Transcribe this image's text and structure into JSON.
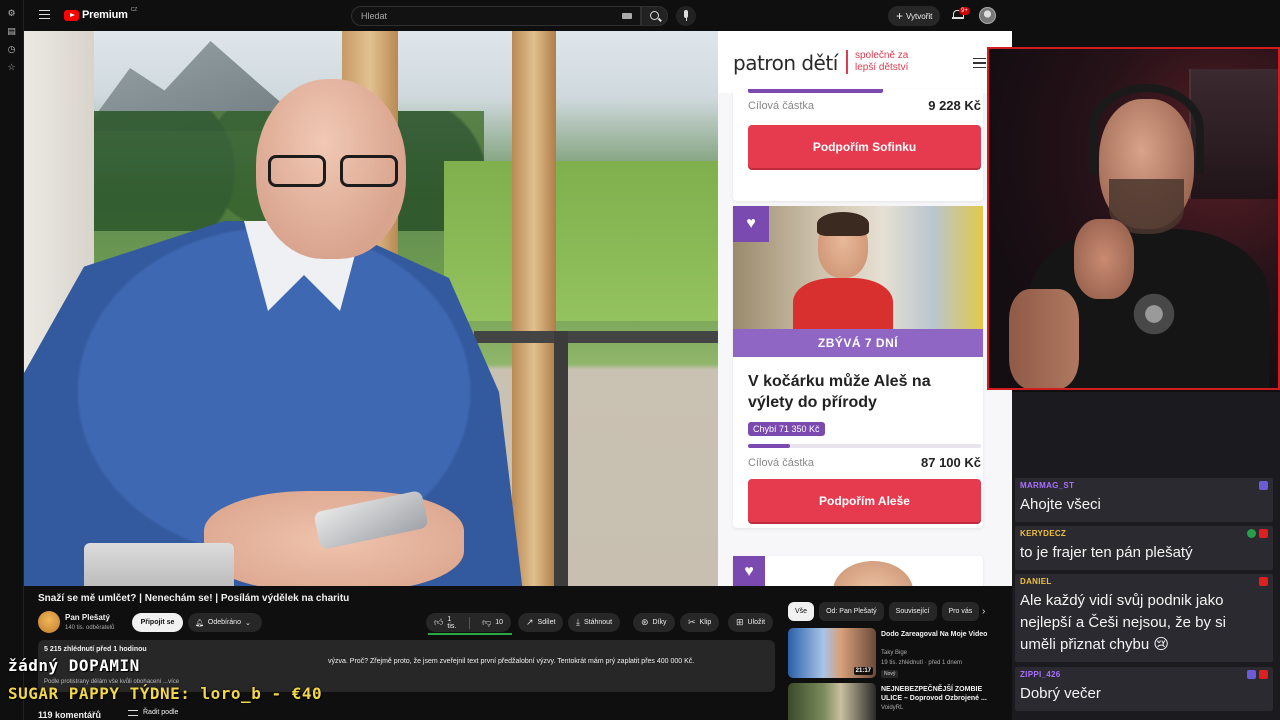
{
  "topbar": {
    "logo_text": "Premium",
    "logo_region": "CZ",
    "search_placeholder": "Hledat",
    "create_label": "Vytvořit",
    "notif_count": "9+"
  },
  "patron": {
    "logo": "patron dětí",
    "tagline_1": "společně za",
    "tagline_2": "lepší dětství",
    "card1": {
      "goal_label": "Cílová částka",
      "goal_value": "9 228 Kč",
      "button": "Podpořím Sofinku"
    },
    "card2": {
      "days_left": "ZBÝVÁ 7 DNÍ",
      "title": "V kočárku může Aleš na výlety do přírody",
      "missing": "Chybí 71 350 Kč",
      "progress": 0.18,
      "goal_label": "Cílová částka",
      "goal_value": "87 100 Kč",
      "button": "Podpořím Aleše"
    }
  },
  "video": {
    "title": "Snaží se mě umlčet? | Nenechám se! | Posílám výdělek na charitu",
    "channel": "Pan Plešatý",
    "subscribers": "140 tis. odběratelů",
    "join": "Připojit se",
    "subscribed": "Odebíráno",
    "likes": "1 tis.",
    "dislikes": "10",
    "share": "Sdílet",
    "download": "Stáhnout",
    "thanks": "Díky",
    "clip": "Klip",
    "save": "Uložit",
    "desc_meta": "5 215 zhlédnutí  před 1 hodinou",
    "desc_text": "výzva. Proč? Zřejmě proto, že jsem zveřejnil text první předžalobní výzvy. Tentokrát mám prý zaplatit přes 400 000 Kč.",
    "desc_text2": "Podle protistrany dělám vše kvůli obohacení ...více",
    "comments": "119 komentářů",
    "sort": "Řadit podle"
  },
  "overlay": {
    "line1": "žádný DOPAMIN",
    "line2": "SUGAR PAPPY TÝDNE: loro_b - €40"
  },
  "related": {
    "chips": [
      "Vše",
      "Od: Pan Plešatý",
      "Související",
      "Pro vás"
    ],
    "items": [
      {
        "title": "Dodo Zareagoval Na Moje Video",
        "channel": "Taky Bige",
        "views": "19 tis. zhlédnutí · před 1 dnem",
        "badge": "Nový",
        "duration": "21:17"
      },
      {
        "title": "NEJNEBEZPEČNĚJŠÍ ZOMBIE ULICE – Doprovod Ozbrojené ...",
        "channel": "VoidyRL",
        "views": "",
        "badge": "",
        "duration": ""
      }
    ]
  },
  "chat": {
    "messages": [
      {
        "user": "MARMAG_ST",
        "text": "Ahojte všeci",
        "color": "#a970ff"
      },
      {
        "user": "KERYDECZ",
        "text": "to je frajer ten pán plešatý",
        "color": "#f0c040"
      },
      {
        "user": "DANIEL",
        "text": "Ale každý vidí svůj podnik jako nejlepší a Češi nejsou, že by si uměli přiznat chybu 😢",
        "color": "#f0c040"
      },
      {
        "user": "ZIPPI_426",
        "text": "Dobrý večer",
        "color": "#a970ff"
      }
    ]
  },
  "colors": {
    "accent_red": "#e63a4f",
    "patron_purple": "#7b4ab0",
    "yt_red": "#ff0000",
    "like_green": "#2ba640"
  }
}
